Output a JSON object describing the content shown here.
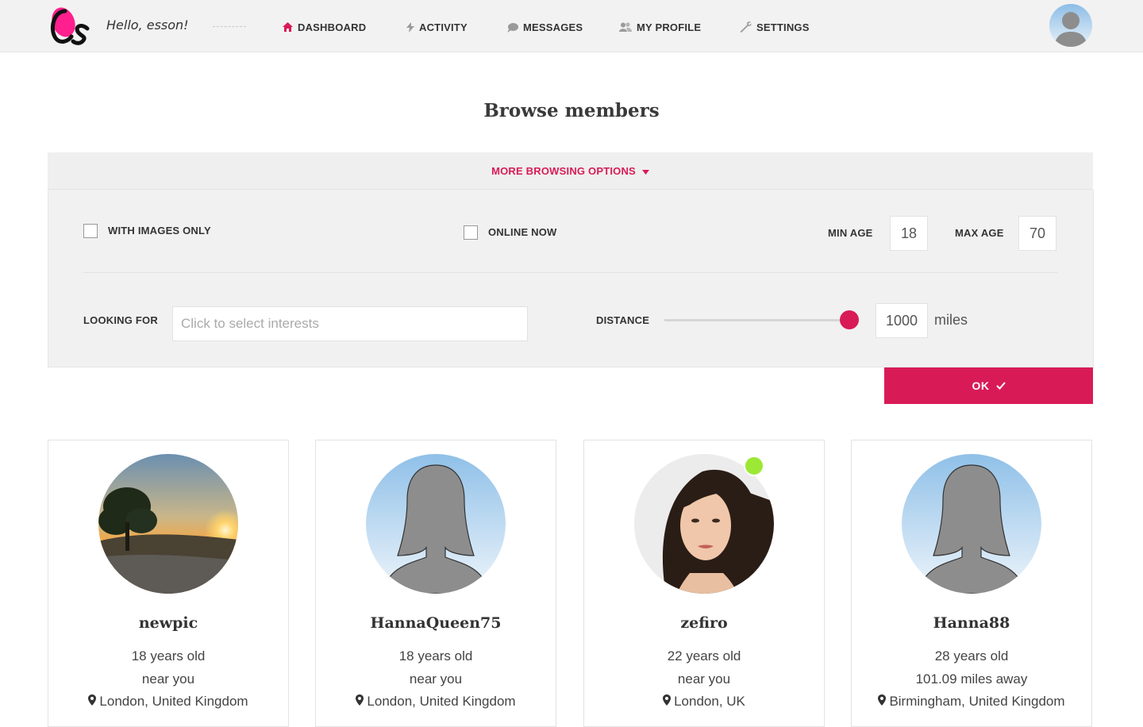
{
  "header": {
    "greeting": "Hello, esson!",
    "nav": [
      {
        "label": "DASHBOARD",
        "icon": "home-icon"
      },
      {
        "label": "ACTIVITY",
        "icon": "bolt-icon"
      },
      {
        "label": "MESSAGES",
        "icon": "chat-bubble-icon"
      },
      {
        "label": "MY PROFILE",
        "icon": "users-icon"
      },
      {
        "label": "SETTINGS",
        "icon": "wrench-icon"
      }
    ],
    "accent_color": "#d81b57"
  },
  "page": {
    "title": "Browse members"
  },
  "filters": {
    "toggle_label": "MORE BROWSING OPTIONS",
    "with_images_label": "WITH IMAGES ONLY",
    "with_images_checked": false,
    "online_now_label": "ONLINE NOW",
    "online_now_checked": false,
    "min_age_label": "MIN AGE",
    "min_age_value": "18",
    "max_age_label": "MAX AGE",
    "max_age_value": "70",
    "looking_for_label": "LOOKING FOR",
    "looking_for_placeholder": "Click to select interests",
    "distance_label": "DISTANCE",
    "distance_value": "1000",
    "distance_unit": "miles",
    "distance_slider_fraction": 1.0,
    "ok_label": "OK"
  },
  "members": [
    {
      "name": "newpic",
      "age": "18 years old",
      "distance": "near you",
      "location": "London, United Kingdom",
      "photo": "sunset-photo",
      "online": false
    },
    {
      "name": "HannaQueen75",
      "age": "18 years old",
      "distance": "near you",
      "location": "London, United Kingdom",
      "photo": "female-silhouette",
      "online": false
    },
    {
      "name": "zefiro",
      "age": "22 years old",
      "distance": "near you",
      "location": "London, UK",
      "photo": "portrait-photo",
      "online": true
    },
    {
      "name": "Hanna88",
      "age": "28 years old",
      "distance": "101.09 miles away",
      "location": "Birmingham, United Kingdom",
      "photo": "female-silhouette",
      "online": false
    }
  ]
}
